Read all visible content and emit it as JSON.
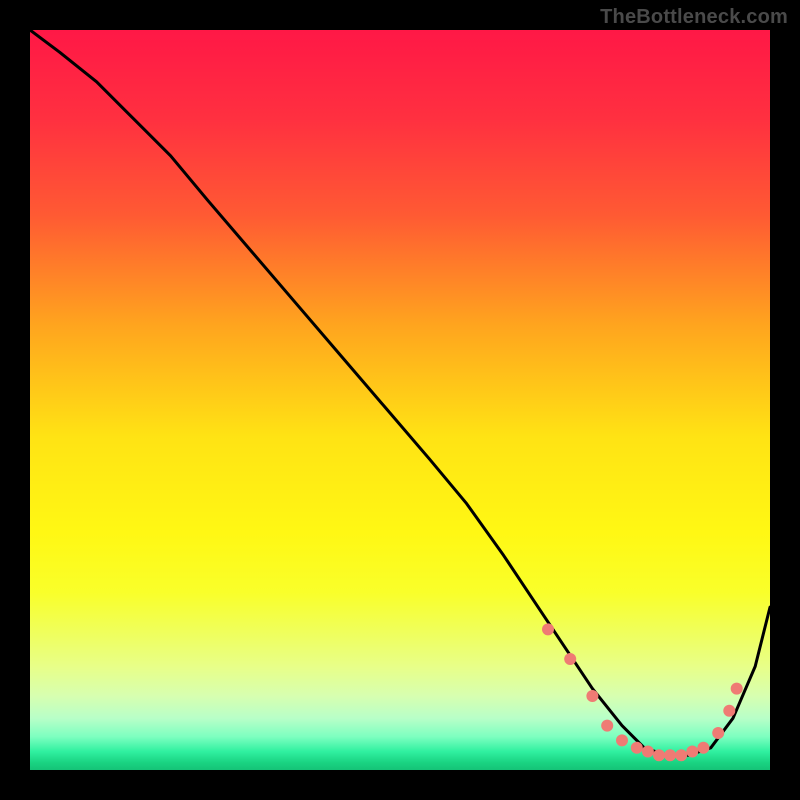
{
  "attribution": "TheBottleneck.com",
  "colors": {
    "frame_bg": "#000000",
    "curve": "#000000",
    "marker_fill": "#ef7b74"
  },
  "gradient_stops": [
    {
      "offset": 0.0,
      "color": "#ff1846"
    },
    {
      "offset": 0.12,
      "color": "#ff3040"
    },
    {
      "offset": 0.25,
      "color": "#ff5a33"
    },
    {
      "offset": 0.4,
      "color": "#ffa51e"
    },
    {
      "offset": 0.55,
      "color": "#ffe314"
    },
    {
      "offset": 0.68,
      "color": "#fff814"
    },
    {
      "offset": 0.76,
      "color": "#f9ff2a"
    },
    {
      "offset": 0.81,
      "color": "#f0ff58"
    },
    {
      "offset": 0.86,
      "color": "#e8ff88"
    },
    {
      "offset": 0.9,
      "color": "#d7ffb0"
    },
    {
      "offset": 0.93,
      "color": "#b8ffc8"
    },
    {
      "offset": 0.955,
      "color": "#7dffc0"
    },
    {
      "offset": 0.975,
      "color": "#30f0a0"
    },
    {
      "offset": 0.99,
      "color": "#1ad382"
    },
    {
      "offset": 1.0,
      "color": "#15c377"
    }
  ],
  "chart_data": {
    "type": "line",
    "title": "",
    "xlabel": "",
    "ylabel": "",
    "xlim": [
      0,
      100
    ],
    "ylim": [
      0,
      100
    ],
    "series": [
      {
        "name": "bottleneck-curve",
        "x": [
          0,
          4,
          9,
          14,
          19,
          24,
          30,
          36,
          42,
          48,
          54,
          59,
          64,
          68,
          72,
          76,
          80,
          83,
          86,
          89,
          92,
          95,
          98,
          100
        ],
        "y": [
          100,
          97,
          93,
          88,
          83,
          77,
          70,
          63,
          56,
          49,
          42,
          36,
          29,
          23,
          17,
          11,
          6,
          3,
          2,
          2,
          3,
          7,
          14,
          22
        ]
      }
    ],
    "markers": {
      "series": "bottleneck-curve",
      "points": [
        {
          "x": 70,
          "y": 19
        },
        {
          "x": 73,
          "y": 15
        },
        {
          "x": 76,
          "y": 10
        },
        {
          "x": 78,
          "y": 6
        },
        {
          "x": 80,
          "y": 4
        },
        {
          "x": 82,
          "y": 3
        },
        {
          "x": 83.5,
          "y": 2.5
        },
        {
          "x": 85,
          "y": 2
        },
        {
          "x": 86.5,
          "y": 2
        },
        {
          "x": 88,
          "y": 2
        },
        {
          "x": 89.5,
          "y": 2.5
        },
        {
          "x": 91,
          "y": 3
        },
        {
          "x": 93,
          "y": 5
        },
        {
          "x": 94.5,
          "y": 8
        },
        {
          "x": 95.5,
          "y": 11
        }
      ],
      "radius_px": 6
    }
  }
}
